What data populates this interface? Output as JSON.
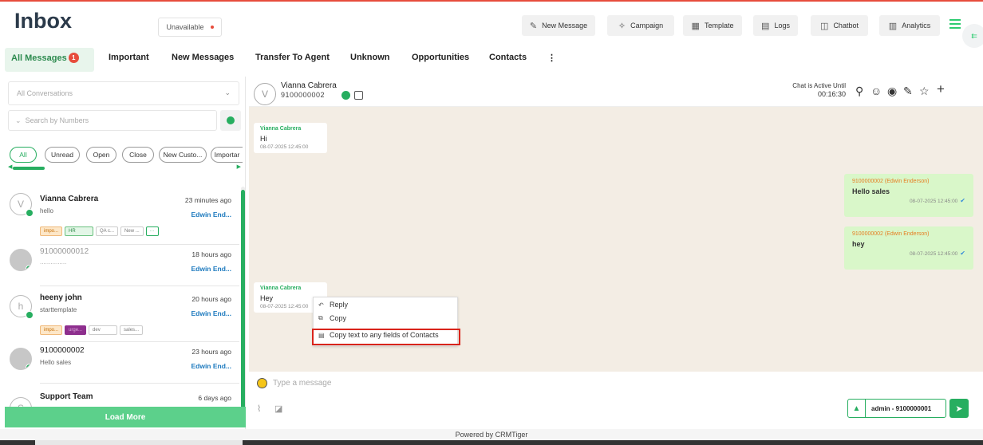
{
  "header": {
    "title": "Inbox",
    "status": "Unavailable",
    "buttons": [
      {
        "label": "New Message",
        "icon": "new-message-icon"
      },
      {
        "label": "Campaign",
        "icon": "campaign-icon"
      },
      {
        "label": "Template",
        "icon": "template-icon"
      },
      {
        "label": "Logs",
        "icon": "logs-icon"
      },
      {
        "label": "Chatbot",
        "icon": "chatbot-icon"
      },
      {
        "label": "Analytics",
        "icon": "analytics-icon"
      }
    ]
  },
  "tabs": [
    {
      "label": "All Messages",
      "badge": "1",
      "active": true
    },
    {
      "label": "Important"
    },
    {
      "label": "New Messages"
    },
    {
      "label": "Transfer To Agent"
    },
    {
      "label": "Unknown"
    },
    {
      "label": "Opportunities"
    },
    {
      "label": "Contacts"
    }
  ],
  "sidebar": {
    "conversation_filter": "All Conversations",
    "search_placeholder": "Search by Numbers",
    "chips": [
      "All",
      "Unread",
      "Open",
      "Close",
      "New Custo...",
      "Importar"
    ],
    "conversations": [
      {
        "name": "Vianna Cabrera",
        "message": "hello",
        "time": "23 minutes ago",
        "agent": "Edwin End...",
        "avatar_letter": "V",
        "tags": [
          "impo...",
          "HR",
          "QA c...",
          "New ..."
        ]
      },
      {
        "name": "91000000012",
        "message": "...............",
        "time": "18 hours ago",
        "agent": "Edwin End..."
      },
      {
        "name": "heeny john",
        "message": "starttemplate",
        "time": "20 hours ago",
        "agent": "Edwin End...",
        "avatar_letter": "h",
        "tags": [
          "impo...",
          "urge...",
          "dev",
          "sales..."
        ]
      },
      {
        "name": "9100000002",
        "message": "Hello sales",
        "time": "23 hours ago",
        "agent": "Edwin End..."
      },
      {
        "name": "Support Team",
        "message": "",
        "time": "6 days ago",
        "avatar_letter": "S"
      }
    ],
    "load_more": "Load More"
  },
  "chat": {
    "contact_name": "Vianna Cabrera",
    "contact_phone": "9100000002",
    "avatar_letter": "V",
    "active_until_label": "Chat is Active Until",
    "active_until_time": "00:16:30",
    "messages": [
      {
        "direction": "in",
        "sender": "Vianna Cabrera",
        "text": "Hi",
        "timestamp": "08-07-2025 12:45:00"
      },
      {
        "direction": "out",
        "sender": "9100000002 (Edwin Enderson)",
        "text": "Hello sales",
        "timestamp": "08-07-2025 12:45:00"
      },
      {
        "direction": "out",
        "sender": "9100000002 (Edwin Enderson)",
        "text": "hey",
        "timestamp": "08-07-2025 12:45:00"
      },
      {
        "direction": "in",
        "sender": "Vianna Cabrera",
        "text": "Hey",
        "timestamp": "08-07-2025 12:45:00"
      }
    ],
    "context_menu": [
      "Reply",
      "Copy",
      "Copy text to any fields of Contacts"
    ],
    "composer_placeholder": "Type a message",
    "sender_value": "admin - 9100000001"
  },
  "footer": "Powered by CRMTiger",
  "colors": {
    "accent": "#27ae60",
    "alert": "#e74c3c",
    "link": "#1f7bbf"
  }
}
